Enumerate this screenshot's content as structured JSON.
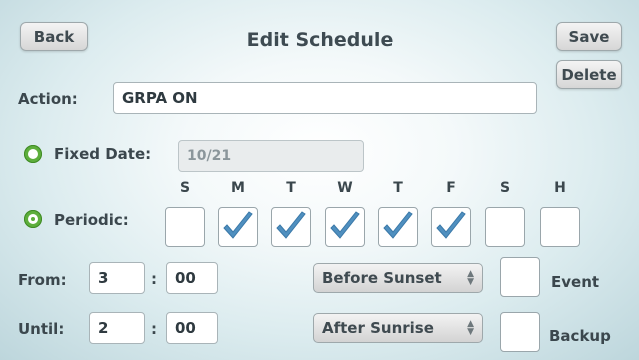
{
  "header": {
    "back_label": "Back",
    "title": "Edit Schedule",
    "save_label": "Save",
    "delete_label": "Delete"
  },
  "action": {
    "label": "Action:",
    "value": "GRPA ON"
  },
  "fixed_date": {
    "label": "Fixed Date:",
    "value": "10/21",
    "selected": false
  },
  "periodic": {
    "label": "Periodic:",
    "selected": true,
    "days": [
      {
        "label": "S",
        "checked": false
      },
      {
        "label": "M",
        "checked": true
      },
      {
        "label": "T",
        "checked": true
      },
      {
        "label": "W",
        "checked": true
      },
      {
        "label": "T",
        "checked": true
      },
      {
        "label": "F",
        "checked": true
      },
      {
        "label": "S",
        "checked": false
      },
      {
        "label": "H",
        "checked": false
      }
    ]
  },
  "from": {
    "label": "From:",
    "hour": "3",
    "separator": ":",
    "minute": "00",
    "relative": "Before Sunset",
    "option_label": "Event"
  },
  "until": {
    "label": "Until:",
    "hour": "2",
    "separator": ":",
    "minute": "00",
    "relative": "After Sunrise",
    "option_label": "Backup"
  },
  "colors": {
    "radio_green": "#5dae3c",
    "check_blue": "#4f8fbf"
  }
}
